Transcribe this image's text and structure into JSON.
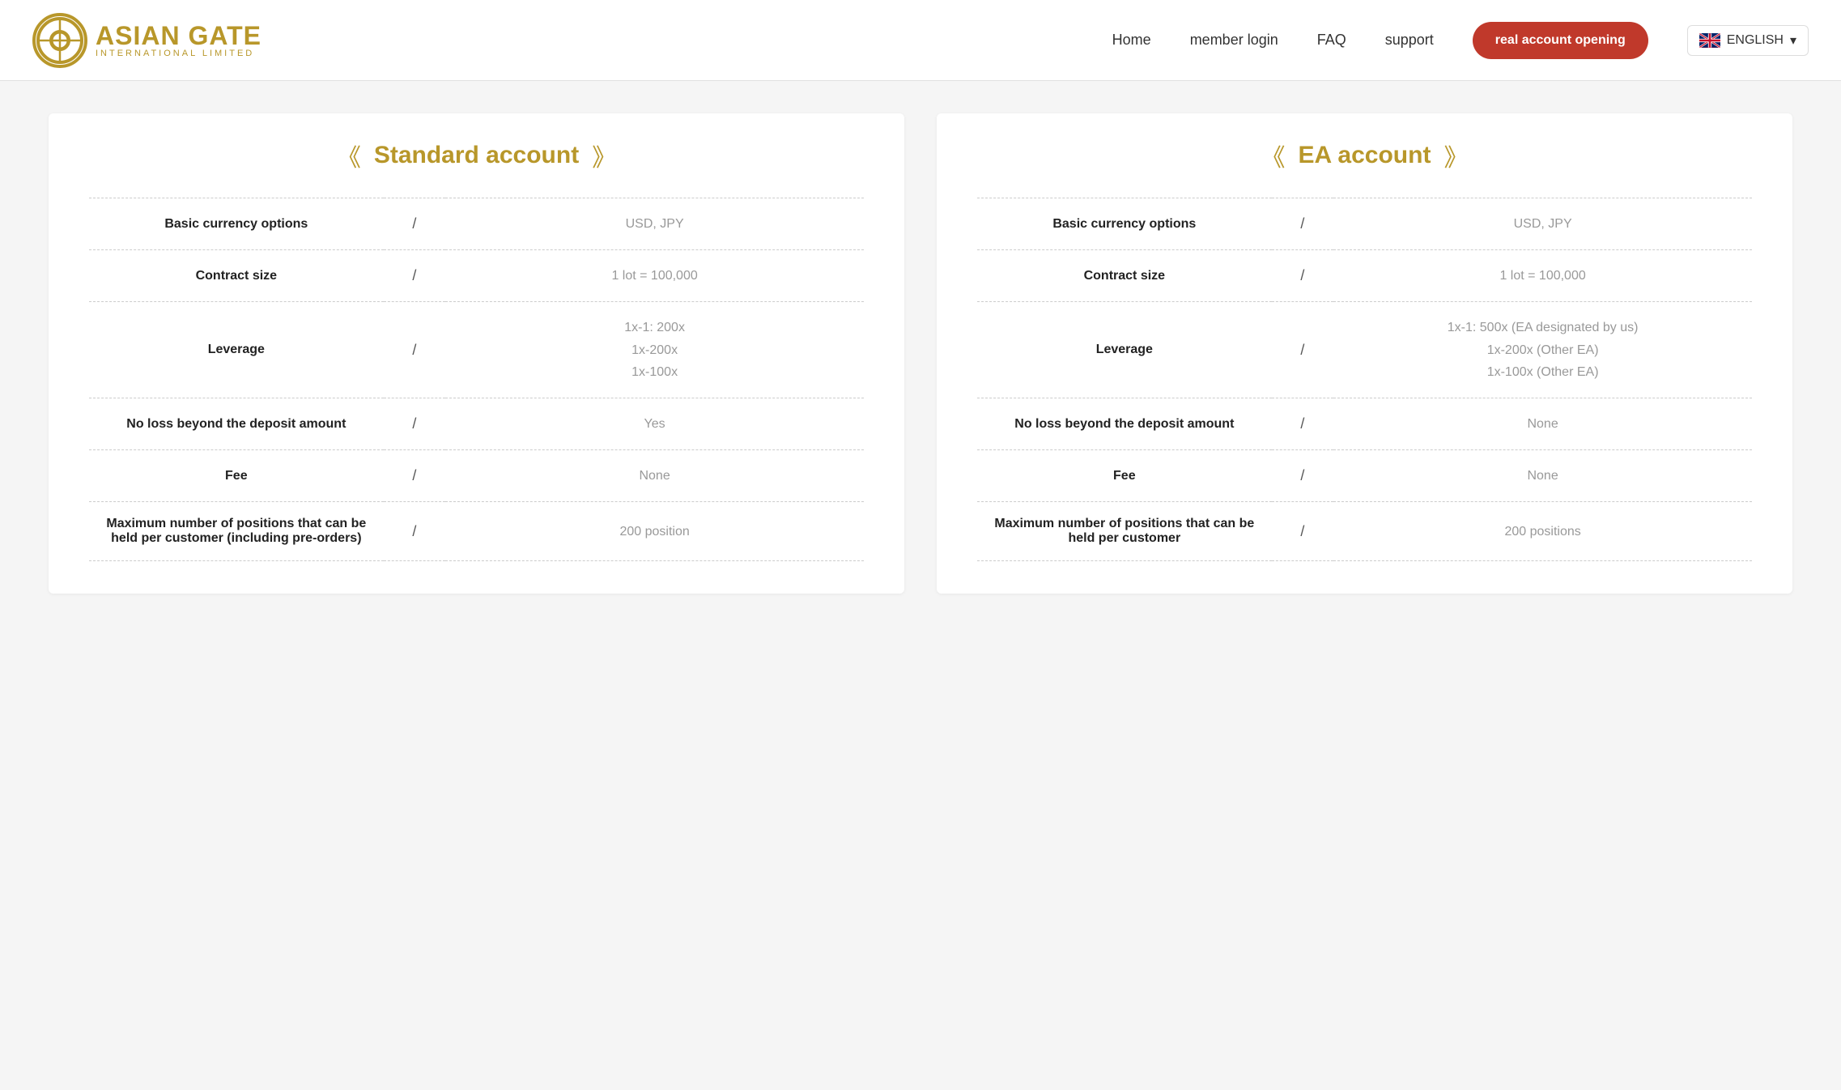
{
  "header": {
    "logo": {
      "main": "ASIAN GATE",
      "sub": "INTERNATIONAL LIMITED"
    },
    "nav": {
      "home": "Home",
      "member_login": "member login",
      "faq": "FAQ",
      "support": "support"
    },
    "cta_button": "real account opening",
    "language": "ENGLISH"
  },
  "accounts": [
    {
      "id": "standard",
      "title": "Standard account",
      "rows": [
        {
          "label": "Basic currency options",
          "sep": "/",
          "value": "USD, JPY"
        },
        {
          "label": "Contract size",
          "sep": "/",
          "value": "1 lot = 100,000"
        },
        {
          "label": "Leverage",
          "sep": "/",
          "value": "1x-1: 200x\n1x-200x\n1x-100x"
        },
        {
          "label": "No loss beyond the deposit amount",
          "sep": "/",
          "value": "Yes"
        },
        {
          "label": "Fee",
          "sep": "/",
          "value": "None"
        },
        {
          "label": "Maximum number of positions that can be held per customer (including pre-orders)",
          "sep": "/",
          "value": "200 position"
        }
      ]
    },
    {
      "id": "ea",
      "title": "EA account",
      "rows": [
        {
          "label": "Basic currency options",
          "sep": "/",
          "value": "USD, JPY"
        },
        {
          "label": "Contract size",
          "sep": "/",
          "value": "1 lot = 100,000"
        },
        {
          "label": "Leverage",
          "sep": "/",
          "value": "1x-1: 500x (EA designated by us)\n1x-200x (Other EA)\n1x-100x (Other EA)"
        },
        {
          "label": "No loss beyond the deposit amount",
          "sep": "/",
          "value": "None"
        },
        {
          "label": "Fee",
          "sep": "/",
          "value": "None"
        },
        {
          "label": "Maximum number of positions that can be held per customer",
          "sep": "/",
          "value": "200 positions"
        }
      ]
    }
  ]
}
